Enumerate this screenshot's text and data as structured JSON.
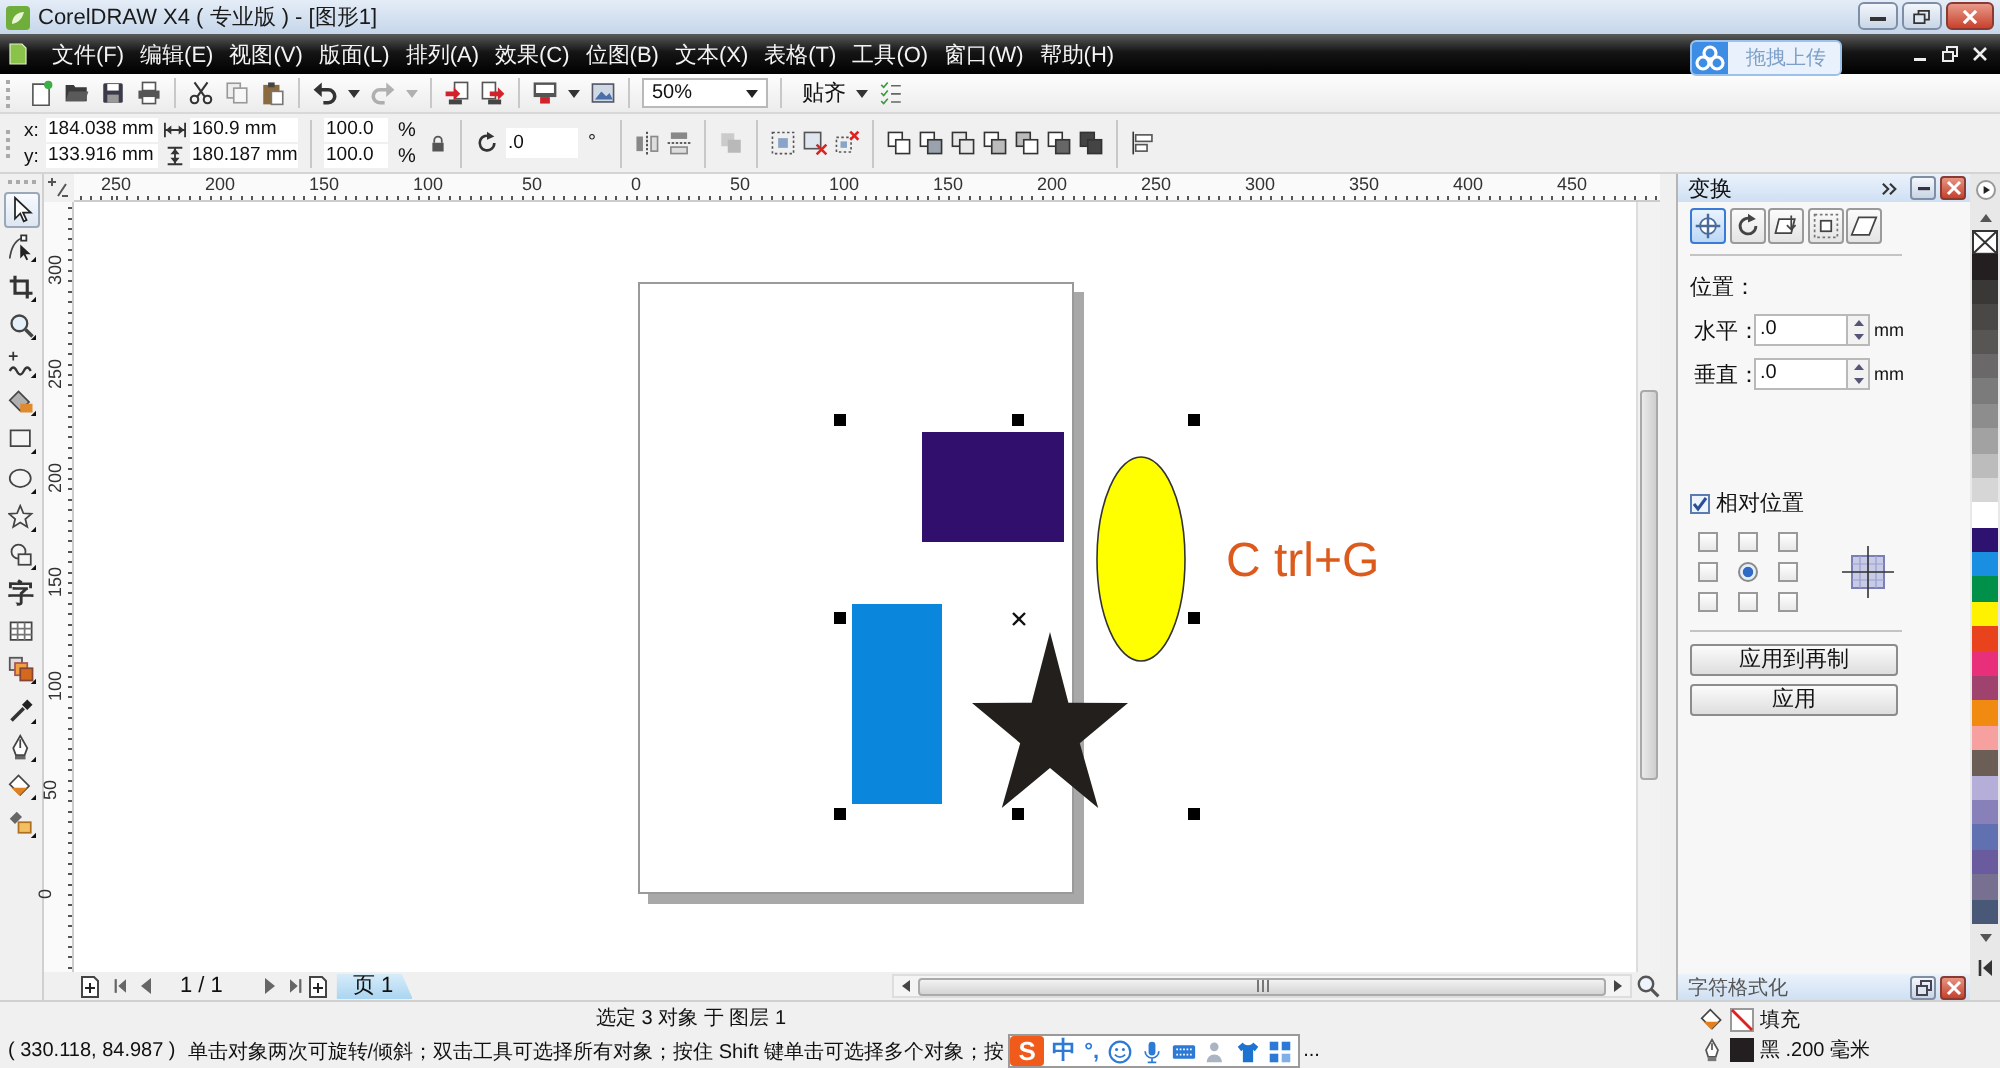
{
  "window": {
    "title": "CorelDRAW X4 ( 专业版 ) - [图形1]"
  },
  "menu": [
    "文件(F)",
    "编辑(E)",
    "视图(V)",
    "版面(L)",
    "排列(A)",
    "效果(C)",
    "位图(B)",
    "文本(X)",
    "表格(T)",
    "工具(O)",
    "窗口(W)",
    "帮助(H)"
  ],
  "upload_button": {
    "label": "拖拽上传"
  },
  "toolbar": {
    "items": [
      {
        "kind": "new",
        "disabled": false
      },
      {
        "kind": "open",
        "disabled": false
      },
      {
        "kind": "save",
        "disabled": false
      },
      {
        "kind": "print",
        "disabled": false
      },
      {
        "kind": "separator"
      },
      {
        "kind": "cut",
        "disabled": false
      },
      {
        "kind": "copy",
        "disabled": false
      },
      {
        "kind": "paste",
        "disabled": false
      },
      {
        "kind": "separator"
      },
      {
        "kind": "undo",
        "disabled": false
      },
      {
        "kind": "dropdown",
        "disabled": false
      },
      {
        "kind": "redo",
        "disabled": true
      },
      {
        "kind": "dropdown",
        "disabled": true
      },
      {
        "kind": "separator"
      },
      {
        "kind": "import",
        "disabled": false
      },
      {
        "kind": "export",
        "disabled": false
      },
      {
        "kind": "separator"
      },
      {
        "kind": "launcher",
        "disabled": false
      },
      {
        "kind": "dropdown",
        "disabled": false
      },
      {
        "kind": "welcome",
        "disabled": false
      },
      {
        "kind": "separator"
      }
    ],
    "zoom": "50%",
    "snap": "贴齐"
  },
  "property_bar": {
    "position": [
      {
        "label": "x:",
        "value": "184.038 mm"
      },
      {
        "label": "y:",
        "value": "133.916 mm"
      }
    ],
    "size": [
      {
        "kind": "width",
        "value": "160.9 mm"
      },
      {
        "kind": "height",
        "value": "180.187 mm"
      }
    ],
    "scale": [
      {
        "value": "100.0",
        "unit": "%"
      },
      {
        "value": "100.0",
        "unit": "%"
      }
    ],
    "rotation": {
      "value": ".0",
      "unit": "°"
    },
    "tools": [
      {
        "kind": "mirror_h",
        "disabled": false
      },
      {
        "kind": "mirror_v",
        "disabled": false
      },
      {
        "kind": "separator"
      },
      {
        "kind": "arrange",
        "disabled": true
      },
      {
        "kind": "separator"
      },
      {
        "kind": "group",
        "disabled": false
      },
      {
        "kind": "ungroup",
        "disabled": false
      },
      {
        "kind": "ungroup_all",
        "disabled": false
      },
      {
        "kind": "separator"
      },
      {
        "kind": "weld",
        "disabled": false
      },
      {
        "kind": "trim",
        "disabled": false
      },
      {
        "kind": "intersect",
        "disabled": false
      },
      {
        "kind": "simplify",
        "disabled": false
      },
      {
        "kind": "front_minus_back",
        "disabled": false
      },
      {
        "kind": "back_minus_front",
        "disabled": false
      },
      {
        "kind": "boundary",
        "disabled": false
      },
      {
        "kind": "separator"
      },
      {
        "kind": "align",
        "disabled": false
      }
    ]
  },
  "rulers": {
    "horizontal": [
      "250",
      "200",
      "150",
      "100",
      "50",
      "0",
      "50",
      "100",
      "150",
      "200",
      "250",
      "300",
      "350",
      "400",
      "450"
    ],
    "vertical": [
      "300",
      "250",
      "200",
      "150",
      "100",
      "50",
      "0"
    ]
  },
  "tools": [
    {
      "kind": "pick",
      "selected": true
    },
    {
      "kind": "shape",
      "selected": false
    },
    {
      "kind": "crop",
      "selected": false
    },
    {
      "kind": "zoom",
      "selected": false
    },
    {
      "kind": "freehand",
      "selected": false
    },
    {
      "kind": "smart_fill",
      "selected": false
    },
    {
      "kind": "rectangle",
      "selected": false
    },
    {
      "kind": "ellipse",
      "selected": false
    },
    {
      "kind": "polygon",
      "selected": false
    },
    {
      "kind": "basic_shapes",
      "selected": false
    },
    {
      "kind": "text",
      "selected": false,
      "label": "字"
    },
    {
      "kind": "table",
      "selected": false
    },
    {
      "kind": "blend",
      "selected": false
    },
    {
      "kind": "eyedropper",
      "selected": false
    },
    {
      "kind": "outline",
      "selected": false
    },
    {
      "kind": "fill",
      "selected": false
    },
    {
      "kind": "interactive_fill",
      "selected": false
    }
  ],
  "canvas": {
    "shapes": [
      {
        "kind": "rectangle",
        "color": "#300f6d"
      },
      {
        "kind": "ellipse",
        "color": "#ffff00"
      },
      {
        "kind": "rectangle",
        "color": "#0a87dc"
      },
      {
        "kind": "star",
        "color": "#231f1c"
      }
    ],
    "text": "C trl+G"
  },
  "page_nav": {
    "counter": "1 / 1",
    "tabs": [
      {
        "label": "页 1",
        "selected": true
      }
    ]
  },
  "docker": {
    "title": "变换",
    "modes": [
      {
        "kind": "position",
        "selected": true
      },
      {
        "kind": "rotate",
        "selected": false
      },
      {
        "kind": "scale",
        "selected": false
      },
      {
        "kind": "size",
        "selected": false
      },
      {
        "kind": "skew",
        "selected": false
      }
    ],
    "section": "位置：",
    "fields": [
      {
        "label": "水平：",
        "value": ".0",
        "unit": "mm"
      },
      {
        "label": "垂直：",
        "value": ".0",
        "unit": "mm"
      }
    ],
    "relative": {
      "label": "相对位置",
      "checked": true
    },
    "anchors": [
      {
        "selected": false
      },
      {
        "selected": false
      },
      {
        "selected": false
      },
      {
        "selected": false
      },
      {
        "selected": true
      },
      {
        "selected": false
      },
      {
        "selected": false
      },
      {
        "selected": false
      },
      {
        "selected": false
      }
    ],
    "buttons": [
      "应用到再制",
      "应用"
    ]
  },
  "docker_tab": {
    "title": "字符格式化"
  },
  "palette": [
    {
      "kind": "none"
    },
    {
      "kind": "swatch",
      "color": "#231f20"
    },
    {
      "kind": "swatch",
      "color": "#3a3836"
    },
    {
      "kind": "swatch",
      "color": "#4a4846"
    },
    {
      "kind": "swatch",
      "color": "#585654"
    },
    {
      "kind": "swatch",
      "color": "#6a6868"
    },
    {
      "kind": "swatch",
      "color": "#7c7b7b"
    },
    {
      "kind": "swatch",
      "color": "#8e8d8d"
    },
    {
      "kind": "swatch",
      "color": "#a3a2a2"
    },
    {
      "kind": "swatch",
      "color": "#bdbcbc"
    },
    {
      "kind": "swatch",
      "color": "#d7d6d6"
    },
    {
      "kind": "swatch",
      "color": "#ffffff"
    },
    {
      "kind": "swatch",
      "color": "#2e1270"
    },
    {
      "kind": "swatch",
      "color": "#1a8ee0"
    },
    {
      "kind": "swatch",
      "color": "#00904a"
    },
    {
      "kind": "swatch",
      "color": "#fff200"
    },
    {
      "kind": "swatch",
      "color": "#e8431c"
    },
    {
      "kind": "swatch",
      "color": "#e8307a"
    },
    {
      "kind": "swatch",
      "color": "#a0426e"
    },
    {
      "kind": "swatch",
      "color": "#f08a10"
    },
    {
      "kind": "swatch",
      "color": "#f7a0a0"
    },
    {
      "kind": "swatch",
      "color": "#6b5e56"
    },
    {
      "kind": "swatch",
      "color": "#b4aed8"
    },
    {
      "kind": "swatch",
      "color": "#8880b8"
    },
    {
      "kind": "swatch",
      "color": "#6070b0"
    },
    {
      "kind": "swatch",
      "color": "#6a5a9e"
    },
    {
      "kind": "swatch",
      "color": "#787090"
    },
    {
      "kind": "swatch",
      "color": "#4a5878"
    }
  ],
  "status_bar": {
    "selection": "选定 3 对象 于 图层 1",
    "coordinates": "( 330.118, 84.987 )",
    "hint": "单击对象两次可旋转/倾斜；双击工具可选择所有对象；按住 Shift 键单击可选择多个对象；按",
    "hint_tail": "...",
    "fill": {
      "kind": "none",
      "label": "填充"
    },
    "outline": {
      "kind": "solid",
      "color": "#231f20",
      "label": "黑 .200 毫米"
    }
  },
  "ime_bar": {
    "logo": "S",
    "mode": "中",
    "punctuation": "°,"
  }
}
